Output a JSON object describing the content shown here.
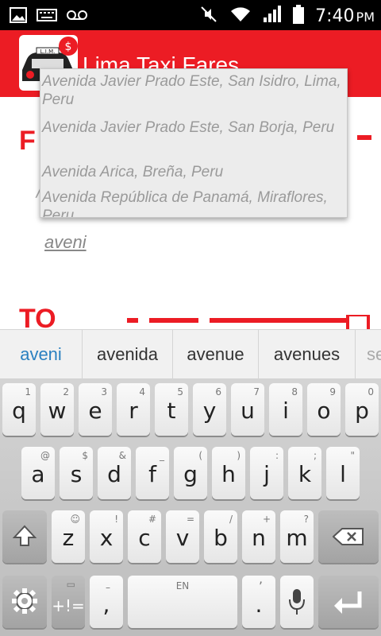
{
  "status_bar": {
    "time": "7:40",
    "ampm": "PM"
  },
  "app_bar": {
    "title": "Lima Taxi Fares",
    "logo_text": "L.I.M."
  },
  "main": {
    "from_label": "F",
    "to_label": "TO",
    "from_input_value": "aveni",
    "hint_behind": "/"
  },
  "dropdown": {
    "items": [
      "Avenida Javier Prado Este, San Isidro, Lima, Peru",
      "Avenida Javier Prado Este, San Borja, Peru",
      "Avenida Arica, Breña, Peru",
      "Avenida República de Panamá, Miraflores, Peru"
    ]
  },
  "suggestions": [
    "aveni",
    "avenida",
    "avenue",
    "avenues",
    "se"
  ],
  "keyboard": {
    "row1": [
      {
        "k": "q",
        "h": "1"
      },
      {
        "k": "w",
        "h": "2"
      },
      {
        "k": "e",
        "h": "3"
      },
      {
        "k": "r",
        "h": "4"
      },
      {
        "k": "t",
        "h": "5"
      },
      {
        "k": "y",
        "h": "6"
      },
      {
        "k": "u",
        "h": "7"
      },
      {
        "k": "i",
        "h": "8"
      },
      {
        "k": "o",
        "h": "9"
      },
      {
        "k": "p",
        "h": "0"
      }
    ],
    "row2": [
      {
        "k": "a",
        "h": "@"
      },
      {
        "k": "s",
        "h": "$"
      },
      {
        "k": "d",
        "h": "&"
      },
      {
        "k": "f",
        "h": "_"
      },
      {
        "k": "g",
        "h": "("
      },
      {
        "k": "h",
        "h": ")"
      },
      {
        "k": "j",
        "h": ":"
      },
      {
        "k": "k",
        "h": ";"
      },
      {
        "k": "l",
        "h": "\""
      }
    ],
    "row3": [
      {
        "k": "z",
        "h": "☺"
      },
      {
        "k": "x",
        "h": "!"
      },
      {
        "k": "c",
        "h": "#"
      },
      {
        "k": "v",
        "h": "="
      },
      {
        "k": "b",
        "h": "/"
      },
      {
        "k": "n",
        "h": "+"
      },
      {
        "k": "m",
        "h": "?"
      }
    ],
    "symbols_key": "+!=",
    "comma_key": ",",
    "comma_hint": "–",
    "space_hint": "EN",
    "period_key": ".",
    "period_hint": "’"
  },
  "colors": {
    "brand_red": "#ec1c24",
    "suggest_blue": "#2a80c0"
  }
}
